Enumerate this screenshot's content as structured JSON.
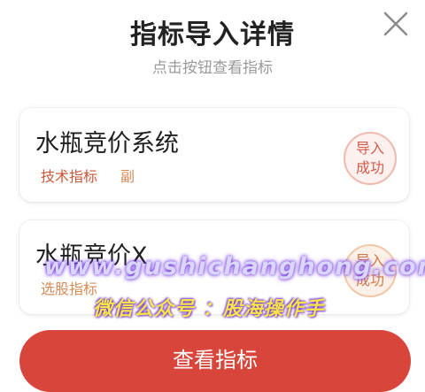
{
  "dialog": {
    "title": "指标导入详情",
    "subtitle": "点击按钮查看指标",
    "close_icon": "close-icon"
  },
  "indicators": [
    {
      "name": "水瓶竞价系统",
      "tags": [
        "技术指标",
        "副"
      ],
      "status_line1": "导入",
      "status_line2": "成功"
    },
    {
      "name": "水瓶竞价X",
      "tags": [
        "选股指标"
      ],
      "status_line1": "导入",
      "status_line2": "成功"
    }
  ],
  "watermark": {
    "url": "www.gushichanghong.com",
    "wechat": "微信公众号 ：股海操作手"
  },
  "button": {
    "label": "查看指标"
  },
  "colors": {
    "accent": "#d8463b",
    "stamp_red": "#d65a4a",
    "tag": "#c8593b"
  }
}
